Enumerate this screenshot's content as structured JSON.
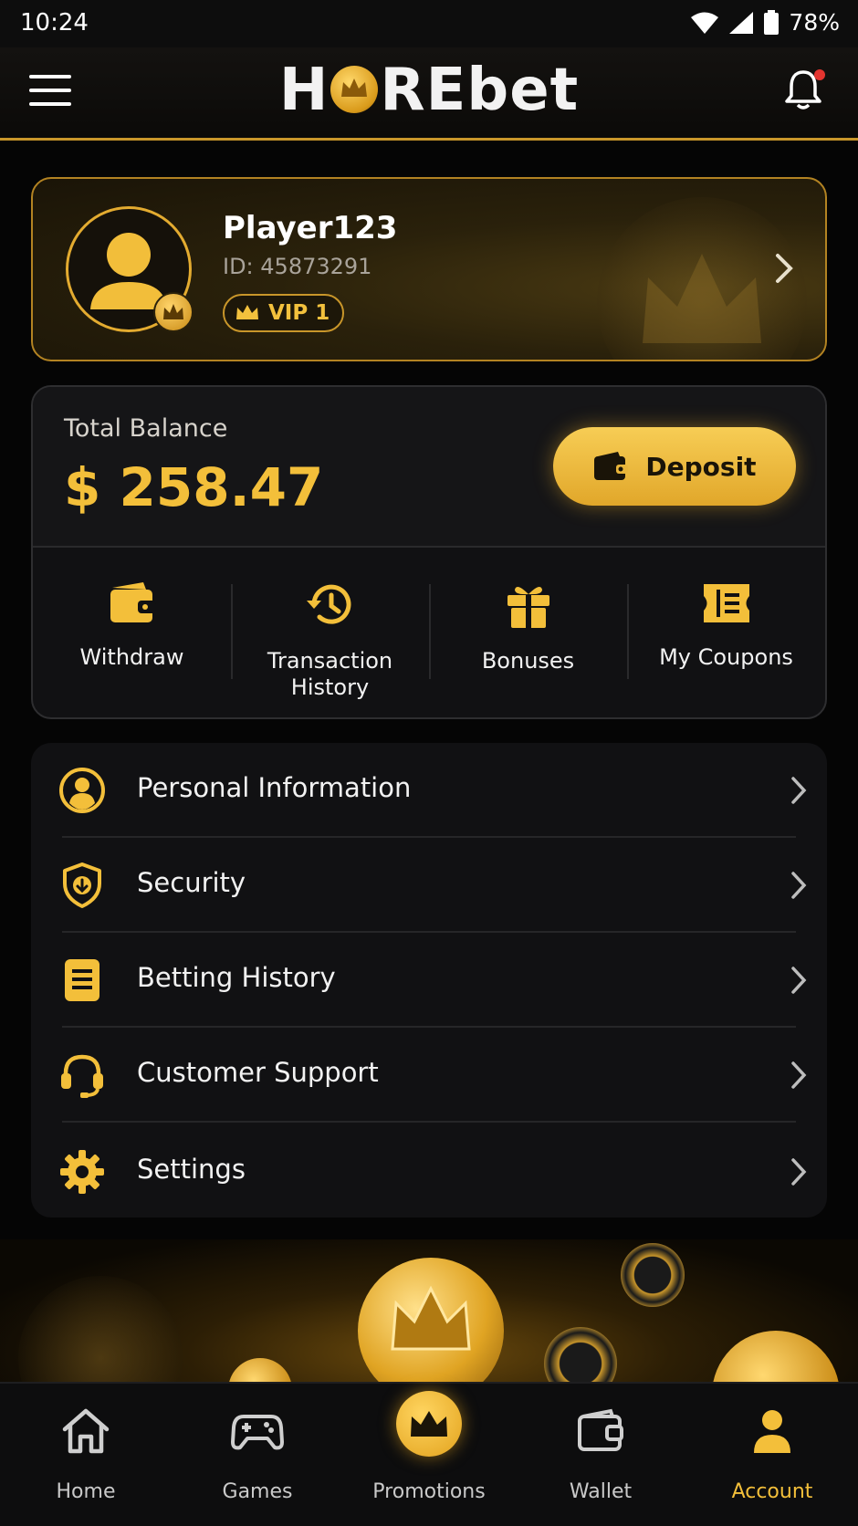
{
  "status_bar": {
    "time": "10:24",
    "battery": "78%"
  },
  "header": {
    "logo_left": "H",
    "logo_right": "REbet"
  },
  "profile": {
    "name": "Player123",
    "id_text": "ID: 45873291",
    "vip": "VIP 1"
  },
  "balance": {
    "label": "Total Balance",
    "value": "$ 258.47",
    "deposit_label": "Deposit",
    "actions": [
      {
        "label": "Withdraw"
      },
      {
        "label": "Transaction History"
      },
      {
        "label": "Bonuses"
      },
      {
        "label": "My Coupons"
      }
    ]
  },
  "menu": [
    {
      "label": "Personal Information",
      "icon": "user-circle-icon"
    },
    {
      "label": "Security",
      "icon": "shield-icon"
    },
    {
      "label": "Betting History",
      "icon": "document-icon"
    },
    {
      "label": "Customer Support",
      "icon": "headset-icon"
    },
    {
      "label": "Settings",
      "icon": "gear-icon"
    }
  ],
  "bottom_nav": [
    {
      "label": "Home",
      "icon": "home-icon"
    },
    {
      "label": "Games",
      "icon": "gamepad-icon"
    },
    {
      "label": "Promotions",
      "icon": "crown-icon"
    },
    {
      "label": "Wallet",
      "icon": "wallet-icon"
    },
    {
      "label": "Account",
      "icon": "person-icon",
      "active": true
    }
  ],
  "colors": {
    "gold": "#f3bf3a",
    "gold_border": "#c9962a",
    "background": "#050505",
    "card": "#111113"
  }
}
